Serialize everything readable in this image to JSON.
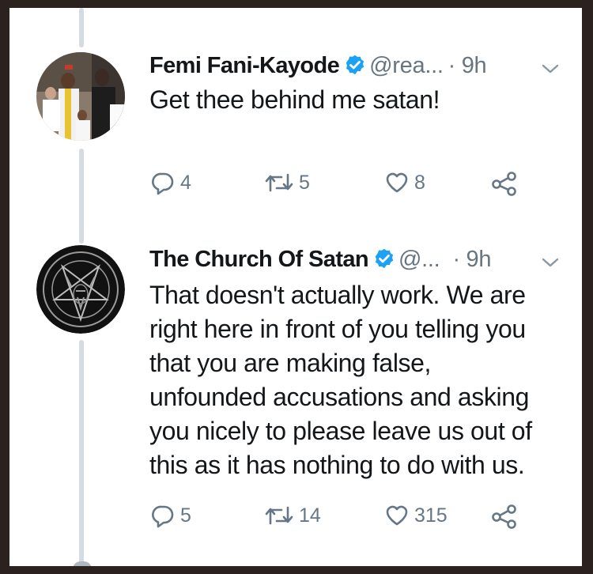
{
  "tweets": [
    {
      "name": "Femi Fani-Kayode",
      "handle": "@rea...",
      "time": "· 9h",
      "text": "Get thee behind me satan!",
      "replies": "4",
      "retweets": "5",
      "likes": "8"
    },
    {
      "name": "The Church Of Satan",
      "handle": "@...",
      "time": "· 9h",
      "text": "That doesn't actually work. We are right here in front of you telling you that you are making false, unfounded accusations and asking you nicely to please leave us out of this as it has nothing to do with us.",
      "text_lines": [
        "That doesn't actually work. We are",
        "right here in front of you telling you",
        "that you are making false,",
        "unfounded accusations and asking",
        "you nicely to please leave us out of",
        "this as it has nothing to do with us."
      ],
      "replies": "5",
      "retweets": "14",
      "likes": "315"
    }
  ],
  "icons": [
    "verified-badge-icon",
    "chevron-down-icon",
    "reply-icon",
    "retweet-icon",
    "like-icon",
    "share-icon"
  ],
  "colors": {
    "verified": "#1da1f2",
    "icon_gray": "#657786",
    "thread_line": "#d4dbe1"
  }
}
